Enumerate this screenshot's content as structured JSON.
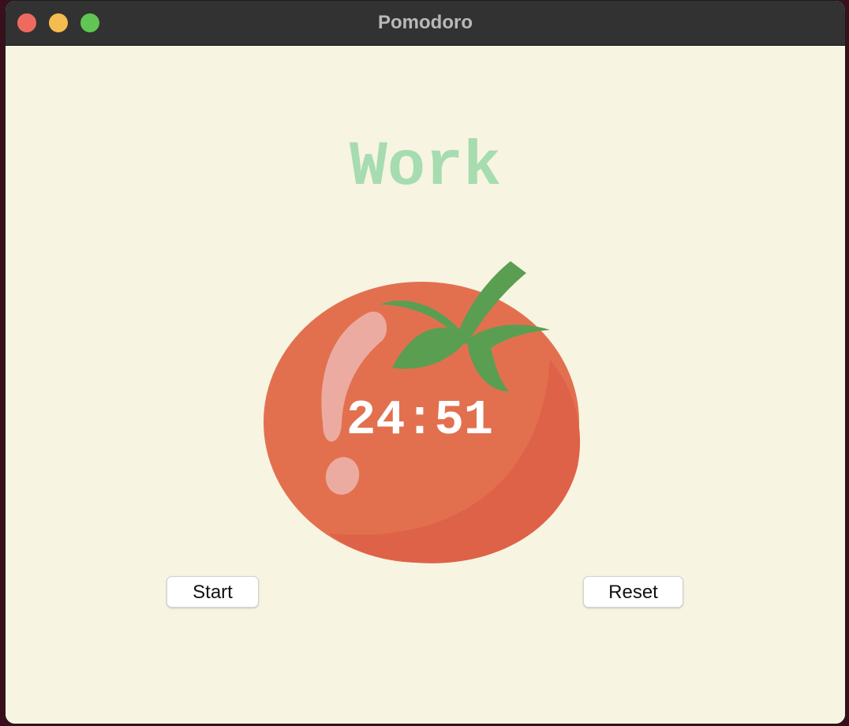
{
  "window": {
    "title": "Pomodoro",
    "controls": [
      "close",
      "minimize",
      "maximize"
    ]
  },
  "mode": {
    "label": "Work",
    "color": "#a6dcb0"
  },
  "timer": {
    "display": "24:51"
  },
  "image": {
    "name": "tomato-icon"
  },
  "buttons": {
    "start_label": "Start",
    "reset_label": "Reset"
  },
  "colors": {
    "background": "#f7f4e1",
    "tomato": "#e2704f",
    "leaf": "#5a9e52",
    "titlebar": "#323232"
  }
}
